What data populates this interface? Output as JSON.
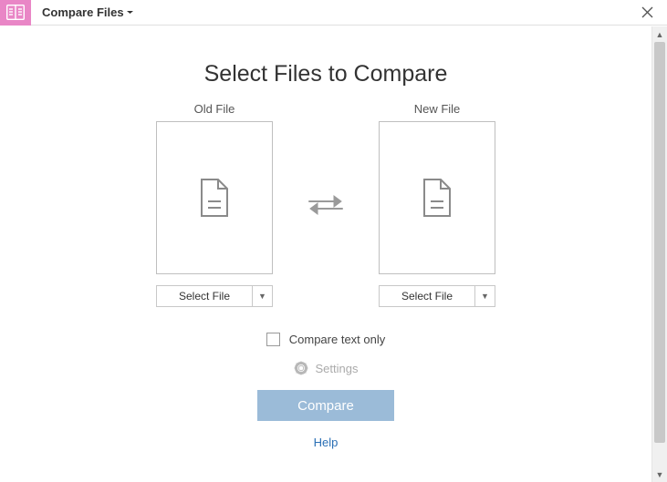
{
  "titlebar": {
    "title": "Compare Files"
  },
  "heading": "Select Files to Compare",
  "left": {
    "label": "Old File",
    "select": "Select File"
  },
  "right": {
    "label": "New File",
    "select": "Select File"
  },
  "options": {
    "compare_text": "Compare text only",
    "settings": "Settings",
    "compare": "Compare",
    "help": "Help"
  }
}
